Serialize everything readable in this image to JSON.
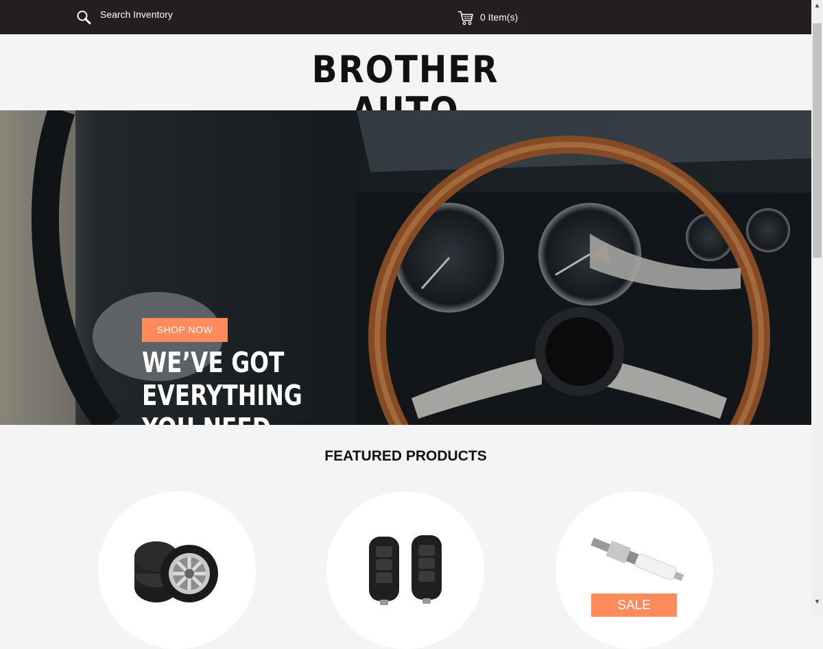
{
  "topbar": {
    "search_label": "Search Inventory",
    "cart_label": "0 Item(s)"
  },
  "header": {
    "logo_text": "BROTHER AUTO"
  },
  "hero": {
    "title_line1": "WE’VE GOT EVERYTHING",
    "title_line2": "YOU NEED",
    "button_label": "SHOP NOW"
  },
  "featured": {
    "title": "FEATURED PRODUCTS",
    "products": [
      {
        "icon": "tires-icon"
      },
      {
        "icon": "car-key-fob-icon"
      },
      {
        "icon": "spark-plug-icon",
        "badge": "SALE"
      }
    ]
  },
  "colors": {
    "topbar": "#231f20",
    "accent": "#ff8a5b",
    "background": "#f4f4f4"
  }
}
